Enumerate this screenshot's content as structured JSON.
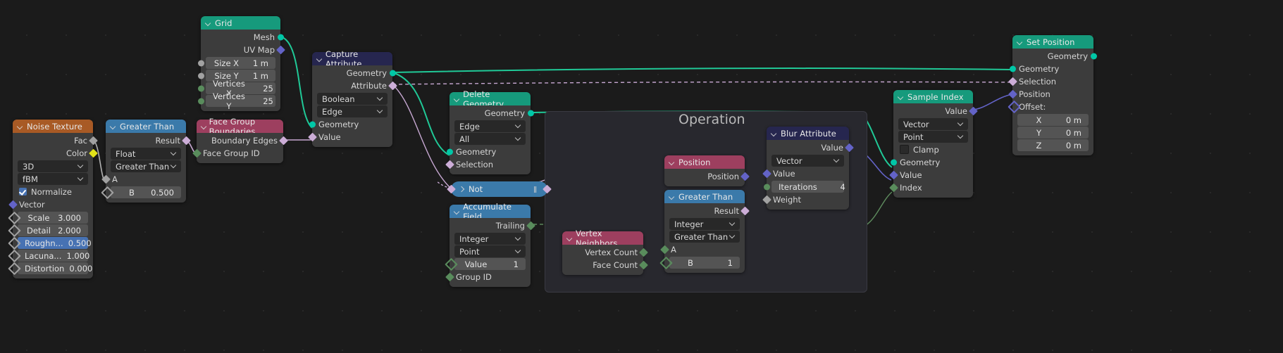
{
  "frame": {
    "label": "Operation"
  },
  "nodes": {
    "noise_texture": {
      "title": "Noise Texture",
      "outputs": [
        "Fac",
        "Color"
      ],
      "dropdowns": [
        "3D",
        "fBM"
      ],
      "checkbox": {
        "label": "Normalize",
        "checked": true
      },
      "inputs": [
        "Vector"
      ],
      "values": [
        {
          "label": "Scale",
          "value": "3.000",
          "selected": false
        },
        {
          "label": "Detail",
          "value": "2.000",
          "selected": false
        },
        {
          "label": "Roughn...",
          "value": "0.500",
          "selected": true
        },
        {
          "label": "Lacuna...",
          "value": "1.000",
          "selected": false
        },
        {
          "label": "Distortion",
          "value": "0.000",
          "selected": false
        }
      ]
    },
    "greater_than_left": {
      "title": "Greater Than",
      "outputs": [
        "Result"
      ],
      "dropdowns": [
        "Float",
        "Greater Than"
      ],
      "inputs": [
        "A"
      ],
      "values": [
        {
          "label": "B",
          "value": "0.500"
        }
      ]
    },
    "grid": {
      "title": "Grid",
      "outputs": [
        "Mesh",
        "UV Map"
      ],
      "values": [
        {
          "label": "Size X",
          "value": "1 m"
        },
        {
          "label": "Size Y",
          "value": "1 m"
        },
        {
          "label": "Vertices X",
          "value": "25"
        },
        {
          "label": "Vertices Y",
          "value": "25"
        }
      ]
    },
    "face_group_boundaries": {
      "title": "Face Group Boundaries",
      "outputs": [
        "Boundary Edges"
      ],
      "inputs": [
        "Face Group ID"
      ]
    },
    "capture_attribute": {
      "title": "Capture Attribute",
      "outputs": [
        "Geometry",
        "Attribute"
      ],
      "dropdowns": [
        "Boolean",
        "Edge"
      ],
      "inputs": [
        "Geometry",
        "Value"
      ]
    },
    "delete_geometry": {
      "title": "Delete Geometry",
      "outputs": [
        "Geometry"
      ],
      "dropdowns": [
        "Edge",
        "All"
      ],
      "inputs": [
        "Geometry",
        "Selection"
      ]
    },
    "not_node": {
      "title": "Not"
    },
    "accumulate_field": {
      "title": "Accumulate Field",
      "outputs": [
        "Trailing"
      ],
      "dropdowns": [
        "Integer",
        "Point"
      ],
      "values": [
        {
          "label": "Value",
          "value": "1"
        }
      ],
      "inputs": [
        "Group ID"
      ]
    },
    "vertex_neighbors": {
      "title": "Vertex Neighbors",
      "outputs": [
        "Vertex Count",
        "Face Count"
      ]
    },
    "position": {
      "title": "Position",
      "outputs": [
        "Position"
      ]
    },
    "greater_than_op": {
      "title": "Greater Than",
      "outputs": [
        "Result"
      ],
      "dropdowns": [
        "Integer",
        "Greater Than"
      ],
      "inputs": [
        "A"
      ],
      "values": [
        {
          "label": "B",
          "value": "1"
        }
      ]
    },
    "blur_attribute": {
      "title": "Blur Attribute",
      "outputs": [
        "Value"
      ],
      "dropdowns": [
        "Vector"
      ],
      "inputs": [
        "Value"
      ],
      "values": [
        {
          "label": "Iterations",
          "value": "4"
        }
      ],
      "inputs2": [
        "Weight"
      ]
    },
    "sample_index": {
      "title": "Sample Index",
      "outputs": [
        "Value"
      ],
      "dropdowns": [
        "Vector",
        "Point"
      ],
      "checkbox": {
        "label": "Clamp",
        "checked": false
      },
      "inputs": [
        "Geometry",
        "Value",
        "Index"
      ]
    },
    "set_position": {
      "title": "Set Position",
      "outputs": [
        "Geometry"
      ],
      "inputs": [
        "Geometry",
        "Selection",
        "Position",
        "Offset:"
      ],
      "values": [
        {
          "label": "X",
          "value": "0 m"
        },
        {
          "label": "Y",
          "value": "0 m"
        },
        {
          "label": "Z",
          "value": "0 m"
        }
      ]
    }
  },
  "colors": {
    "geometry_socket": "#00c7a7",
    "vector_socket": "#6363c7",
    "boolean_socket": "#ccadd7",
    "float_socket": "#a1a1a1",
    "integer_socket": "#598c5c",
    "color_socket": "#e2e219",
    "header_geometry": "#169a7c",
    "header_converter": "#3b7aaa",
    "header_input": "#9d3f5f",
    "header_texture": "#a85a25",
    "header_attribute": "#26264f"
  }
}
